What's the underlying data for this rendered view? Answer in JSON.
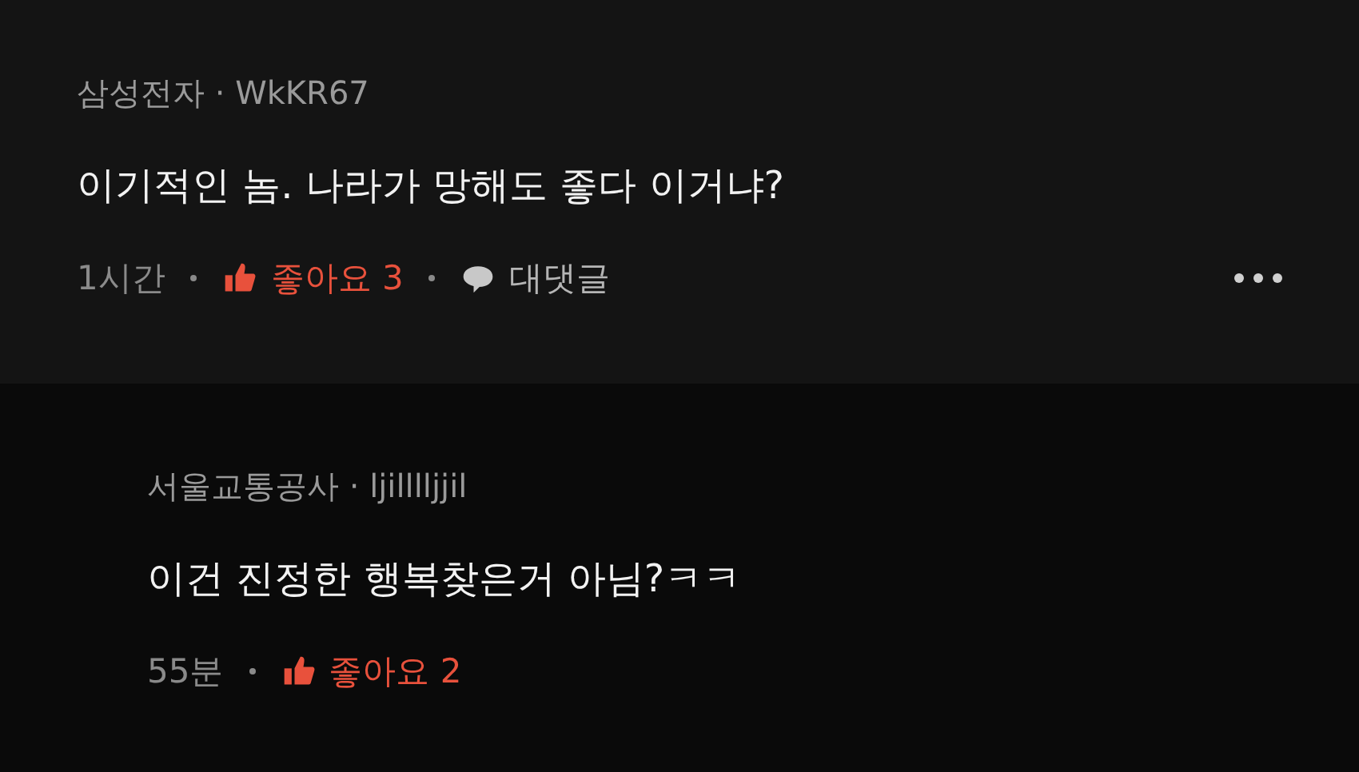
{
  "comments": [
    {
      "kind": "comment",
      "author": "삼성전자 · WkKR67",
      "text": "이기적인 놈. 나라가 망해도 좋다 이거냐?",
      "time": "1시간",
      "like_label": "좋아요 3",
      "liked": true,
      "reply_label": "대댓글",
      "has_menu": true
    },
    {
      "kind": "reply",
      "author": "서울교통공사 · ljilllljjil",
      "text": "이건 진정한 행복찾은거 아님?ㅋㅋ",
      "time": "55분",
      "like_label": "좋아요 2",
      "liked": true,
      "has_menu": false
    }
  ]
}
